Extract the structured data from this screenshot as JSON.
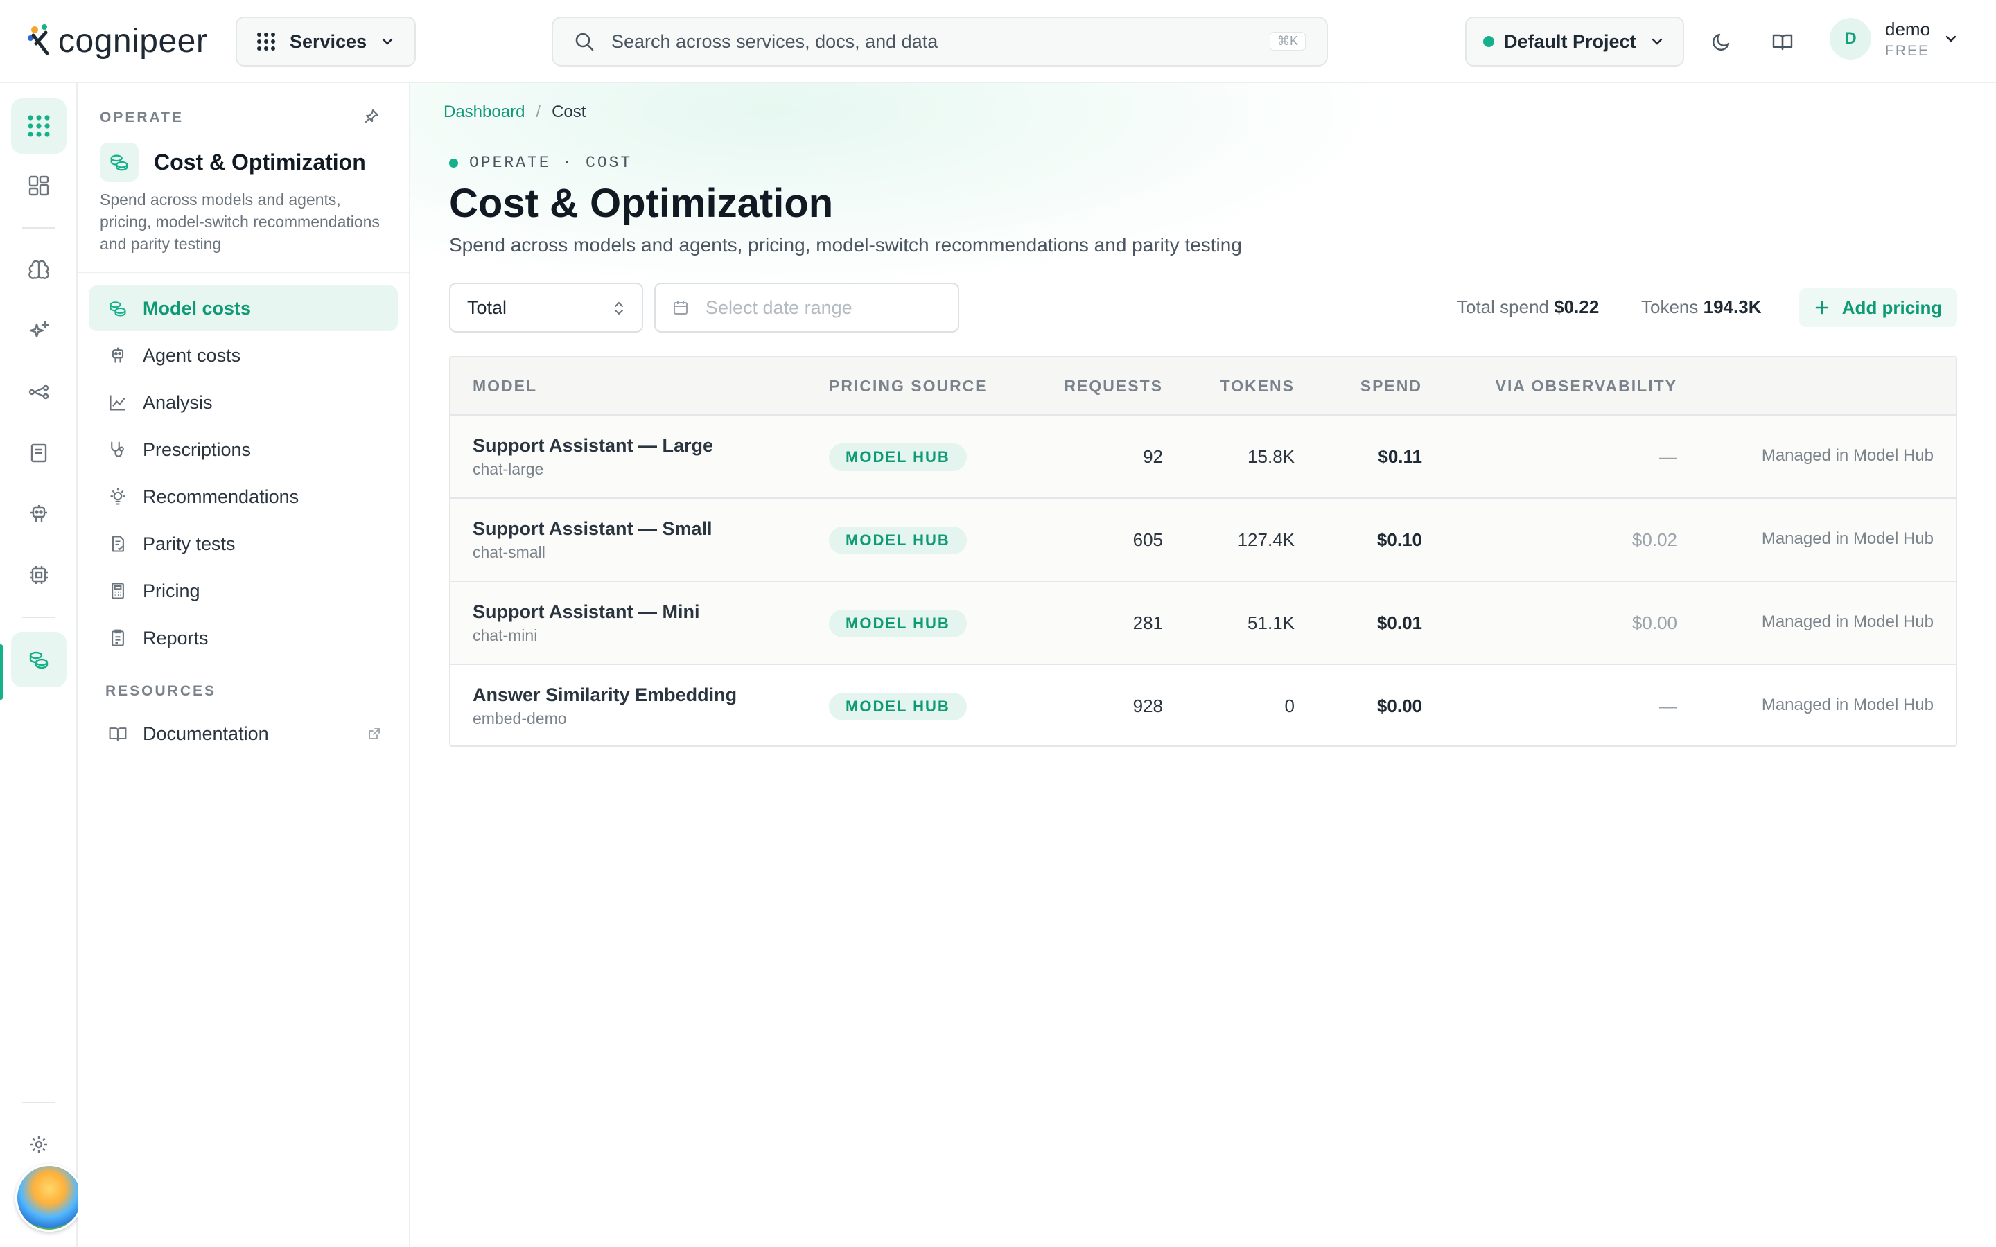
{
  "brand": {
    "name": "cognipeer"
  },
  "topbar": {
    "services_label": "Services",
    "search_placeholder": "Search across services, docs, and data",
    "search_shortcut": "⌘K",
    "project_label": "Default Project",
    "user": {
      "initial": "D",
      "name": "demo",
      "plan": "FREE"
    }
  },
  "subnav": {
    "section_label": "OPERATE",
    "title": "Cost & Optimization",
    "description": "Spend across models and agents, pricing, model-switch recommendations and parity testing",
    "items": [
      {
        "label": "Model costs",
        "icon": "coins-icon",
        "active": true
      },
      {
        "label": "Agent costs",
        "icon": "robot-icon"
      },
      {
        "label": "Analysis",
        "icon": "chart-icon"
      },
      {
        "label": "Prescriptions",
        "icon": "stethoscope-icon"
      },
      {
        "label": "Recommendations",
        "icon": "lightbulb-icon"
      },
      {
        "label": "Parity tests",
        "icon": "clipboard-check-icon"
      },
      {
        "label": "Pricing",
        "icon": "calculator-icon"
      },
      {
        "label": "Reports",
        "icon": "report-icon"
      }
    ],
    "resources_label": "RESOURCES",
    "documentation_label": "Documentation"
  },
  "main": {
    "breadcrumb": {
      "root": "Dashboard",
      "separator": "/",
      "current": "Cost"
    },
    "eyebrow": "OPERATE · COST",
    "title": "Cost & Optimization",
    "subtitle": "Spend across models and agents, pricing, model-switch recommendations and parity testing",
    "filter_value": "Total",
    "date_placeholder": "Select date range",
    "stats": {
      "spend_label": "Total spend",
      "spend_value": "$0.22",
      "tokens_label": "Tokens",
      "tokens_value": "194.3K"
    },
    "add_pricing_label": "Add pricing"
  },
  "table": {
    "columns": [
      "MODEL",
      "PRICING SOURCE",
      "REQUESTS",
      "TOKENS",
      "SPEND",
      "VIA OBSERVABILITY"
    ],
    "rows": [
      {
        "name": "Support Assistant — Large",
        "id": "chat-large",
        "source": "MODEL HUB",
        "requests": "92",
        "tokens": "15.8K",
        "spend": "$0.11",
        "observability": "—",
        "managed": "Managed in Model Hub"
      },
      {
        "name": "Support Assistant — Small",
        "id": "chat-small",
        "source": "MODEL HUB",
        "requests": "605",
        "tokens": "127.4K",
        "spend": "$0.10",
        "observability": "$0.02",
        "managed": "Managed in Model Hub"
      },
      {
        "name": "Support Assistant — Mini",
        "id": "chat-mini",
        "source": "MODEL HUB",
        "requests": "281",
        "tokens": "51.1K",
        "spend": "$0.01",
        "observability": "$0.00",
        "managed": "Managed in Model Hub"
      },
      {
        "name": "Answer Similarity Embedding",
        "id": "embed-demo",
        "source": "MODEL HUB",
        "requests": "928",
        "tokens": "0",
        "spend": "$0.00",
        "observability": "—",
        "managed": "Managed in Model Hub"
      }
    ]
  },
  "colors": {
    "accent": "#16b08a",
    "accent_text": "#0f9a75",
    "accent_bg": "#e8f6f1"
  }
}
